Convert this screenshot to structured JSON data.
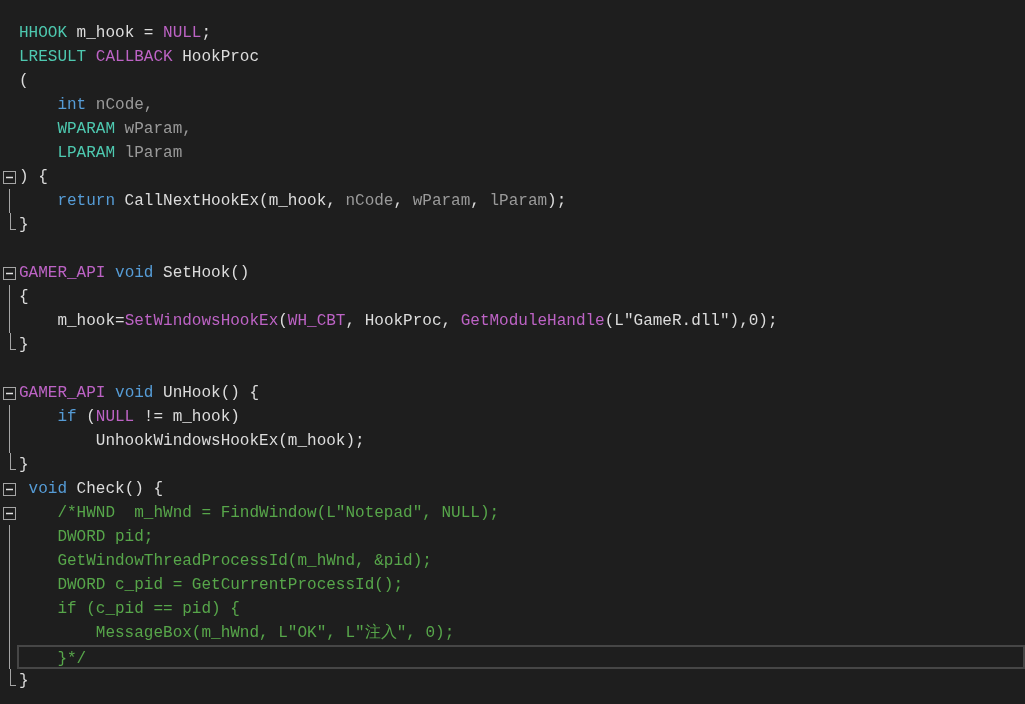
{
  "editor": {
    "lines": [
      {
        "kind": "plain",
        "tokens": [
          {
            "kind": "type",
            "text": "HHOOK"
          },
          {
            "kind": "plain",
            "text": " m_hook = "
          },
          {
            "kind": "macro",
            "text": "NULL"
          },
          {
            "kind": "plain",
            "text": ";"
          }
        ]
      },
      {
        "kind": "plain",
        "tokens": [
          {
            "kind": "type",
            "text": "LRESULT"
          },
          {
            "kind": "macro",
            "text": " CALLBACK"
          },
          {
            "kind": "plain",
            "text": " HookProc"
          }
        ]
      },
      {
        "kind": "plain",
        "tokens": [
          {
            "kind": "plain",
            "text": "("
          }
        ]
      },
      {
        "kind": "plain",
        "tokens": [
          {
            "kind": "keyword",
            "text": "    int"
          },
          {
            "kind": "param",
            "text": " nCode,"
          }
        ]
      },
      {
        "kind": "plain",
        "tokens": [
          {
            "kind": "type",
            "text": "    WPARAM"
          },
          {
            "kind": "param",
            "text": " wParam,"
          }
        ]
      },
      {
        "kind": "plain",
        "tokens": [
          {
            "kind": "type",
            "text": "    LPARAM"
          },
          {
            "kind": "param",
            "text": " lParam"
          }
        ]
      },
      {
        "kind": "fold_start",
        "expanded": true,
        "tokens": [
          {
            "kind": "plain",
            "text": ") {"
          }
        ]
      },
      {
        "kind": "fold_body",
        "tokens": [
          {
            "kind": "keyword",
            "text": "    return"
          },
          {
            "kind": "plain",
            "text": " CallNextHookEx(m_hook, "
          },
          {
            "kind": "param",
            "text": "nCode"
          },
          {
            "kind": "plain",
            "text": ", "
          },
          {
            "kind": "param",
            "text": "wParam"
          },
          {
            "kind": "plain",
            "text": ", "
          },
          {
            "kind": "param",
            "text": "lParam"
          },
          {
            "kind": "plain",
            "text": ");"
          }
        ]
      },
      {
        "kind": "fold_end",
        "tokens": [
          {
            "kind": "plain",
            "text": "}"
          }
        ]
      },
      {
        "kind": "fold_start",
        "expanded": true,
        "blank_before": true,
        "tokens": [
          {
            "kind": "macro",
            "text": "GAMER_API"
          },
          {
            "kind": "keyword",
            "text": " void"
          },
          {
            "kind": "plain",
            "text": " SetHook()"
          }
        ]
      },
      {
        "kind": "fold_body",
        "tokens": [
          {
            "kind": "plain",
            "text": "{"
          }
        ]
      },
      {
        "kind": "fold_body",
        "tokens": [
          {
            "kind": "plain",
            "text": "    m_hook="
          },
          {
            "kind": "macro",
            "text": "SetWindowsHookEx"
          },
          {
            "kind": "plain",
            "text": "("
          },
          {
            "kind": "macro",
            "text": "WH_CBT"
          },
          {
            "kind": "plain",
            "text": ", HookProc, "
          },
          {
            "kind": "macro",
            "text": "GetModuleHandle"
          },
          {
            "kind": "plain",
            "text": "(L\"GameR.dll\"),0);"
          }
        ]
      },
      {
        "kind": "fold_end",
        "tokens": [
          {
            "kind": "plain",
            "text": "}"
          }
        ]
      },
      {
        "kind": "fold_start",
        "expanded": true,
        "blank_before": true,
        "tokens": [
          {
            "kind": "macro",
            "text": "GAMER_API"
          },
          {
            "kind": "keyword",
            "text": " void"
          },
          {
            "kind": "plain",
            "text": " UnHook() {"
          }
        ]
      },
      {
        "kind": "fold_body",
        "tokens": [
          {
            "kind": "keyword",
            "text": "    if"
          },
          {
            "kind": "plain",
            "text": " ("
          },
          {
            "kind": "macro",
            "text": "NULL"
          },
          {
            "kind": "plain",
            "text": " != m_hook)"
          }
        ]
      },
      {
        "kind": "fold_body",
        "tokens": [
          {
            "kind": "plain",
            "text": "        UnhookWindowsHookEx(m_hook);"
          }
        ]
      },
      {
        "kind": "fold_end",
        "tokens": [
          {
            "kind": "plain",
            "text": "}"
          }
        ]
      },
      {
        "kind": "fold_start",
        "expanded": true,
        "tokens": [
          {
            "kind": "keyword",
            "text": " void"
          },
          {
            "kind": "plain",
            "text": " Check() {"
          }
        ]
      },
      {
        "kind": "fold_start",
        "expanded": true,
        "tokens": [
          {
            "kind": "comment",
            "text": "    /*HWND  m_hWnd = FindWindow(L\"Notepad\", NULL);"
          }
        ]
      },
      {
        "kind": "fold_body",
        "tokens": [
          {
            "kind": "comment",
            "text": "    DWORD pid;"
          }
        ]
      },
      {
        "kind": "fold_body",
        "tokens": [
          {
            "kind": "comment",
            "text": "    GetWindowThreadProcessId(m_hWnd, &pid);"
          }
        ]
      },
      {
        "kind": "fold_body",
        "tokens": [
          {
            "kind": "comment",
            "text": "    DWORD c_pid = GetCurrentProcessId();"
          }
        ]
      },
      {
        "kind": "fold_body",
        "tokens": [
          {
            "kind": "comment",
            "text": "    if (c_pid == pid) {"
          }
        ]
      },
      {
        "kind": "fold_body",
        "tokens": [
          {
            "kind": "comment",
            "text": "        MessageBox(m_hWnd, L\"OK\", L\"注入\", 0);"
          }
        ]
      },
      {
        "kind": "fold_body",
        "current": true,
        "tokens": [
          {
            "kind": "comment",
            "text": "    }*/"
          }
        ]
      },
      {
        "kind": "fold_end",
        "tokens": [
          {
            "kind": "plain",
            "text": "}"
          }
        ]
      }
    ]
  }
}
